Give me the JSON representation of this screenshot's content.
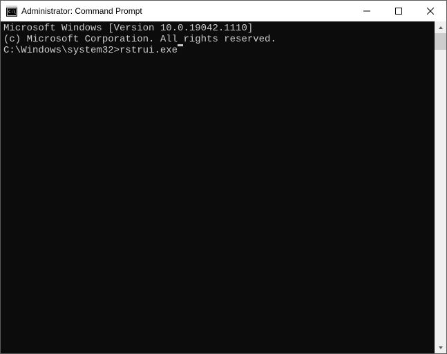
{
  "window": {
    "title": "Administrator: Command Prompt"
  },
  "terminal": {
    "banner_line1": "Microsoft Windows [Version 10.0.19042.1110]",
    "banner_line2": "(c) Microsoft Corporation. All rights reserved.",
    "blank": "",
    "prompt": "C:\\Windows\\system32>",
    "command": "rstrui.exe"
  }
}
